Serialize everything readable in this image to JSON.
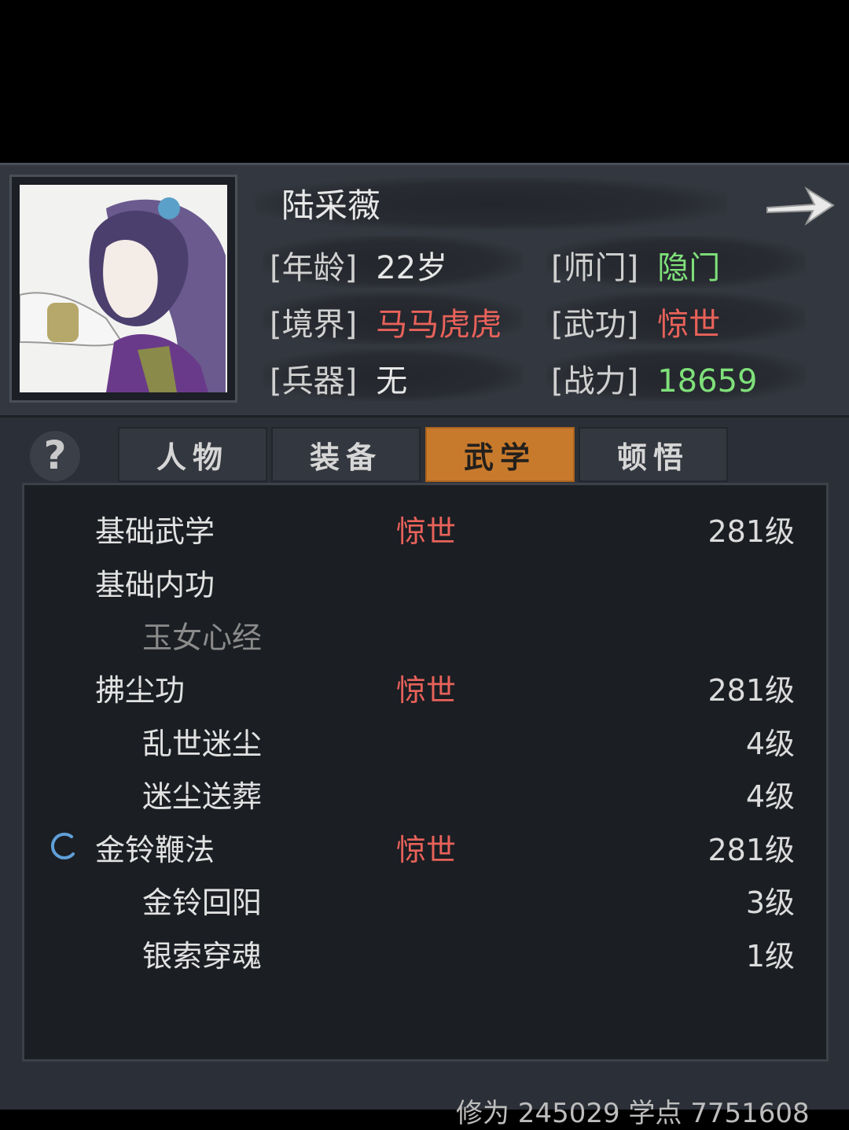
{
  "header": {
    "name": "陆采薇",
    "age_label": "[年龄]",
    "age": "22岁",
    "sect_label": "[师门]",
    "sect": "隐门",
    "realm_label": "[境界]",
    "realm": "马马虎虎",
    "martial_label": "[武功]",
    "martial": "惊世",
    "weapon_label": "[兵器]",
    "weapon": "无",
    "power_label": "[战力]",
    "power": "18659"
  },
  "tabs": [
    {
      "label": "人物"
    },
    {
      "label": "装备"
    },
    {
      "label": "武学",
      "active": true
    },
    {
      "label": "顿悟"
    }
  ],
  "help_symbol": "?",
  "skills": [
    {
      "name": "基础武学",
      "grade": "惊世",
      "level": "281级"
    },
    {
      "name": "基础内功",
      "grade": "",
      "level": ""
    },
    {
      "name": "玉女心经",
      "grade": "",
      "level": ""
    },
    {
      "name": "拂尘功",
      "grade": "惊世",
      "level": "281级"
    },
    {
      "name": "乱世迷尘",
      "grade": "",
      "level": "4级"
    },
    {
      "name": "迷尘送葬",
      "grade": "",
      "level": "4级"
    },
    {
      "name": "金铃鞭法",
      "grade": "惊世",
      "level": "281级"
    },
    {
      "name": "金铃回阳",
      "grade": "",
      "level": "3级"
    },
    {
      "name": "银索穿魂",
      "grade": "",
      "level": "1级"
    }
  ],
  "footer": {
    "text": "修为 245029  学点 7751608"
  },
  "colors": {
    "accent_tab": "#c87a2c",
    "grade_red": "#e8625a",
    "value_green": "#7fe07a"
  }
}
